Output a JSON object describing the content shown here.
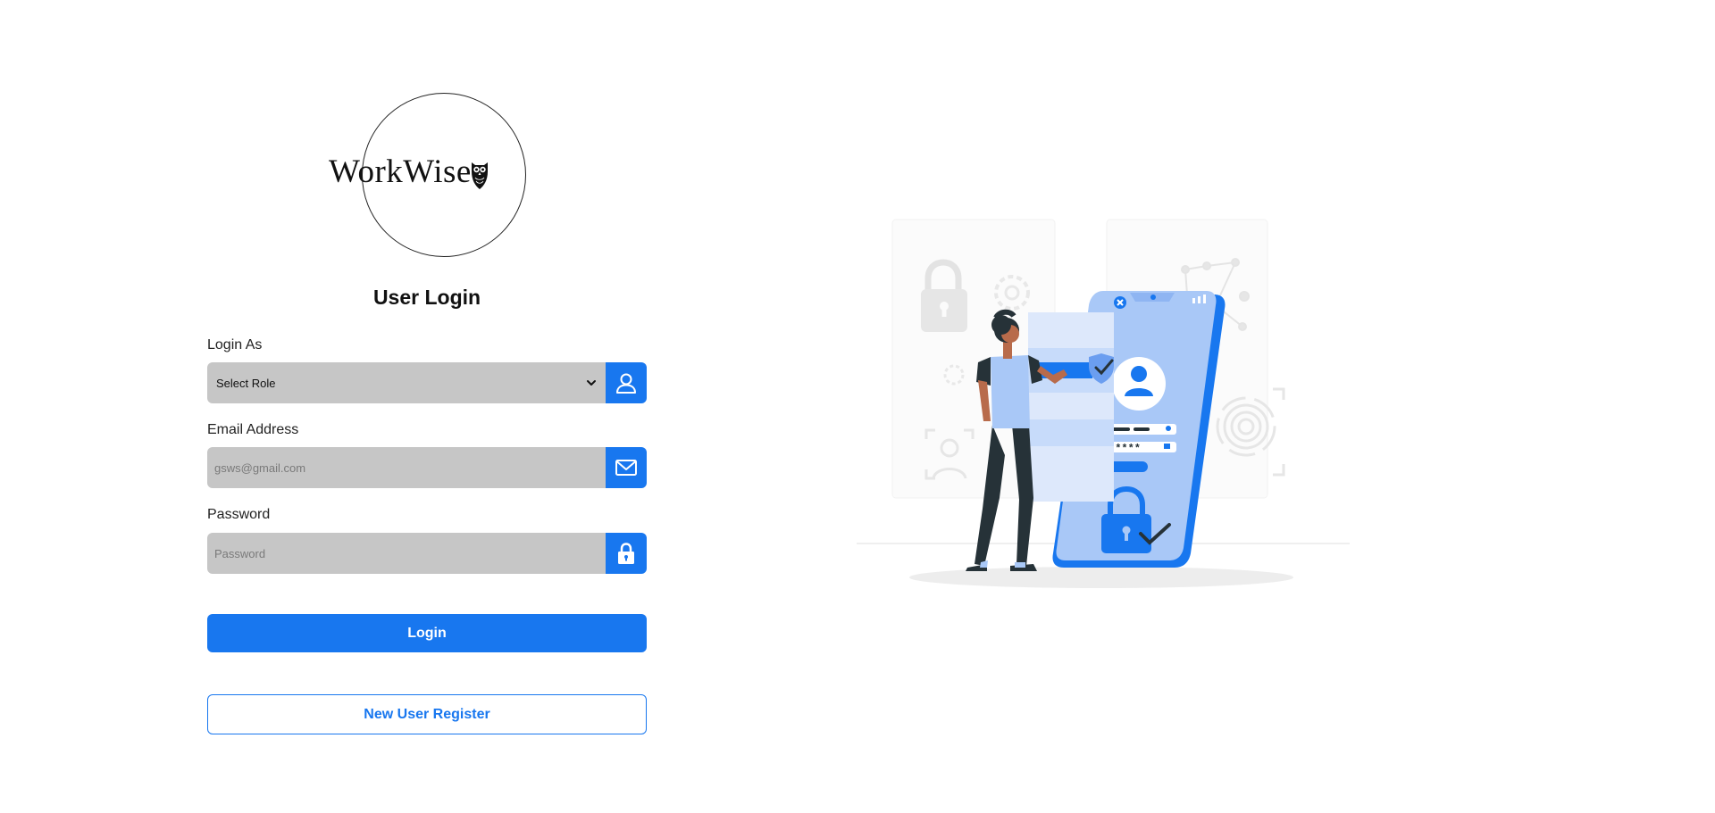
{
  "brand": {
    "logo_text": "WorkWise",
    "accent_color": "#1877ef"
  },
  "form": {
    "title": "User Login",
    "role": {
      "label": "Login As",
      "selected": "Select Role",
      "icon": "user-icon"
    },
    "email": {
      "label": "Email Address",
      "placeholder": "gsws@gmail.com",
      "value": "",
      "icon": "mail-icon"
    },
    "password": {
      "label": "Password",
      "placeholder": "Password",
      "value": "",
      "icon": "lock-icon"
    },
    "login_label": "Login",
    "register_label": "New User Register"
  },
  "illustration": {
    "password_mask": "*****",
    "subject": "login-security-illustration"
  }
}
